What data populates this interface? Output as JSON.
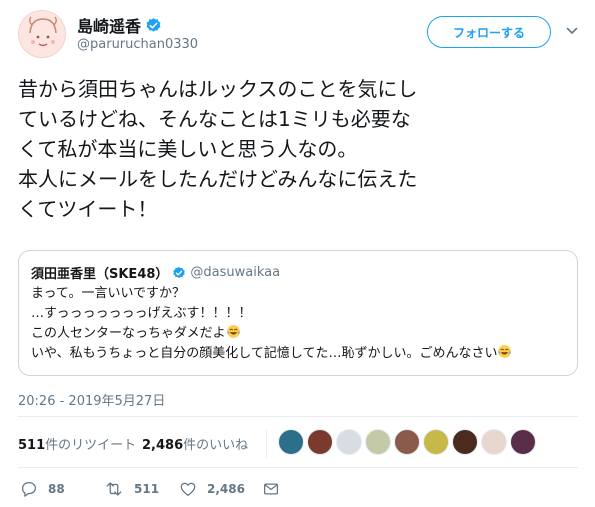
{
  "author": {
    "display_name": "島崎遥香",
    "handle": "@paruruchan0330",
    "avatar_icon": "avatar-doodle-face",
    "verified_icon": "verified-badge-icon"
  },
  "follow_button": {
    "label": "フォローする"
  },
  "menu_icon": "chevron-down-icon",
  "tweet": {
    "text": "昔から須田ちゃんはルックスのことを気にし\nているけどね、そんなことは1ミリも必要な\nくて私が本当に美しいと思う人なの。\n本人にメールをしたんだけどみんなに伝えた\nくてツイート！"
  },
  "quote": {
    "name": "須田亜香里（SKE48）",
    "handle": "@dasuwaikaa",
    "lines": [
      "まって。一言いいですか？",
      "…すっっっっっっっげえぶす！！！！",
      "この人センターなっちゃダメだよ",
      "いや、私もうちょっと自分の顔美化して記憶してた…恥ずかしい。ごめんなさい"
    ],
    "emoji_icon": "tears-of-joy-emoji"
  },
  "timestamp": "20:26 - 2019年5月27日",
  "stats": {
    "retweets_count": "511",
    "retweets_label": "件のリツイート",
    "likes_count": "2,486",
    "likes_label": "件のいいね",
    "liker_colors": [
      "#2b6f8a",
      "#7a3b2e",
      "#d7dde2",
      "#c4c9a8",
      "#8a5a4a",
      "#c7b84a",
      "#4a2b1e",
      "#e9d6cf",
      "#5a2e4a"
    ]
  },
  "actions": {
    "reply_count": "88",
    "retweet_count": "511",
    "like_count": "2,486"
  },
  "colors": {
    "accent": "#1da1f2",
    "secondary_text": "#657786",
    "border": "#e6ecf0"
  }
}
